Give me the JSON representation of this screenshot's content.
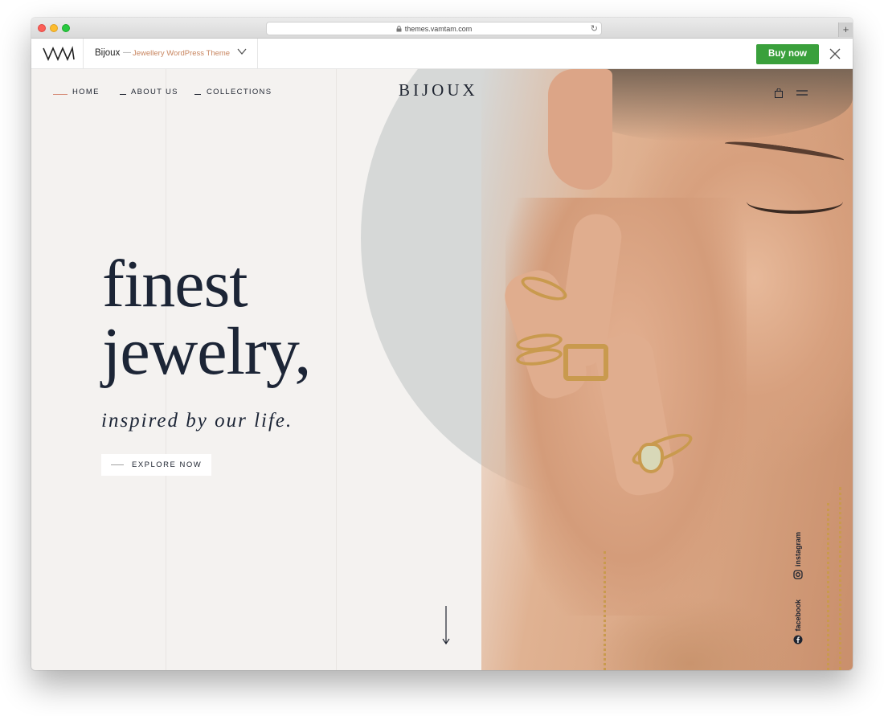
{
  "browser": {
    "url": "themes.vamtam.com",
    "new_tab_label": "+"
  },
  "themebar": {
    "logo": "VAM",
    "theme_name": "Bijoux",
    "dash": "—",
    "theme_subtitle": "Jewellery WordPress Theme",
    "buy_label": "Buy now",
    "buy_color": "#3aa03c"
  },
  "nav": {
    "items": [
      {
        "label": "HOME"
      },
      {
        "label": "ABOUT US"
      },
      {
        "label": "COLLECTIONS"
      }
    ],
    "brand": "BIJOUX"
  },
  "hero": {
    "line1": "finest",
    "line2": "jewelry,",
    "subtitle": "inspired by our life.",
    "cta_label": "EXPLORE NOW"
  },
  "social": {
    "instagram": "instagram",
    "facebook": "facebook"
  },
  "colors": {
    "text_dark": "#1c2536",
    "accent": "#c8855f",
    "background": "#f4f2f0"
  }
}
